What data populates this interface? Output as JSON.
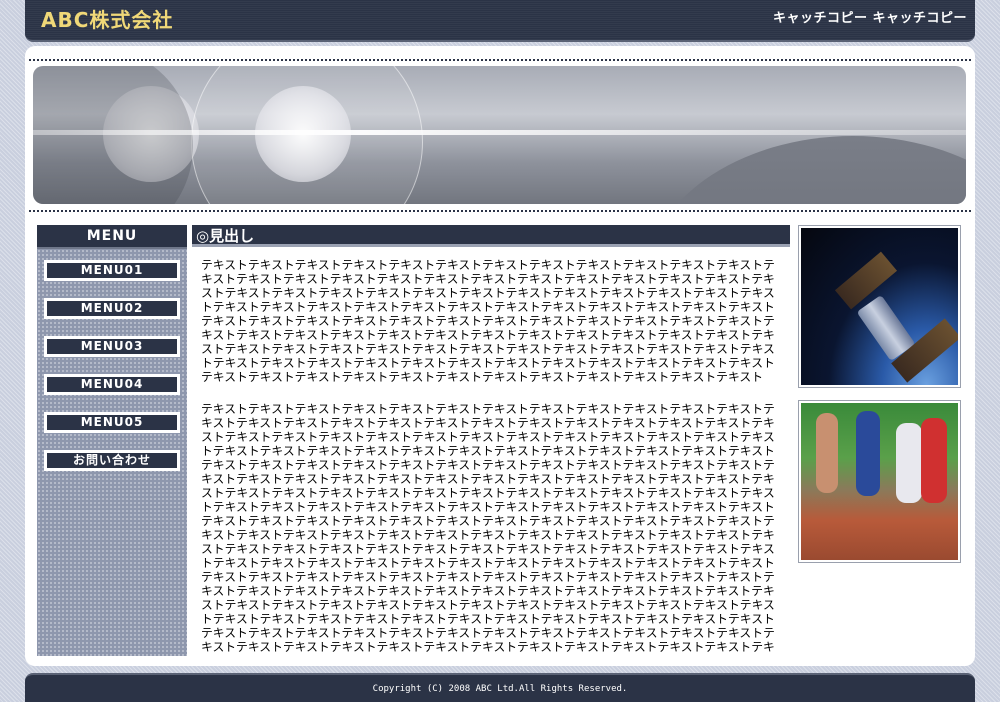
{
  "header": {
    "logo": "ABC株式会社",
    "catch_copy": "キャッチコピー キャッチコピー"
  },
  "menu": {
    "title": "MENU",
    "items": [
      "MENU01",
      "MENU02",
      "MENU03",
      "MENU04",
      "MENU05",
      "お問い合わせ"
    ]
  },
  "main": {
    "heading": "◎見出し",
    "paragraph1": "テキストテキストテキストテキストテキストテキストテキストテキストテキストテキストテキストテキストテキストテキストテキストテキストテキストテキストテキストテキストテキストテキストテキストテキストテキストテキストテキストテキストテキストテキストテキストテキストテキストテキストテキストテキストテキストテキストテキストテキストテキストテキストテキストテキストテキストテキストテキストテキストテキストテキストテキストテキストテキストテキストテキストテキストテキストテキストテキストテキストテキストテキストテキストテキストテキストテキストテキストテキストテキストテキストテキストテキストテキストテキストテキストテキストテキストテキストテキストテキストテキストテキストテキストテキストテキストテキストテキストテキストテキストテキストテキストテキストテキストテキストテキストテキストテキストテキストテキストテキストテキストテキストテキストテキストテキストテキストテキストテキストテキストテキスト",
    "paragraph2": "テキストテキストテキストテキストテキストテキストテキストテキストテキストテキストテキストテキストテキストテキストテキストテキストテキストテキストテキストテキストテキストテキストテキストテキストテキストテキストテキストテキストテキストテキストテキストテキストテキストテキストテキストテキストテキストテキストテキストテキストテキストテキストテキストテキストテキストテキストテキストテキストテキストテキストテキストテキストテキストテキストテキストテキストテキストテキストテキストテキストテキストテキストテキストテキストテキストテキストテキストテキストテキストテキストテキストテキストテキストテキストテキストテキストテキストテキストテキストテキストテキストテキストテキストテキストテキストテキストテキストテキストテキストテキストテキストテキストテキストテキストテキストテキストテキストテキストテキストテキストテキストテキストテキストテキストテキストテキストテキストテキストテキストテキストテキストテキストテキストテキストテキストテキストテキストテキストテキストテキストテキストテキストテキストテキストテキストテキストテキストテキストテキストテキストテキストテキストテキストテキストテキストテキストテキストテキストテキストテキストテキストテキストテキストテキストテキストテキストテキストテキストテキストテキストテキストテキストテキストテキストテキストテキストテキストテキストテキストテキストテキストテキストテキストテキストテキストテキストテキストテキストテキストテキストテキストテキストテキストテキストテキストテキストテキストテキストテキストテキストテキストテキストテキストテキストテキストテキストテキストテキストテキストテキストテキストテキストテキストテキストテキストテキストテキストテキストテキストテキストテキストテキストテキストテキストテキストテキストテキストテキストテキストテキストテキストテキストテキストテキストテキストテキストテキストテキストテキストテキストテキストテキストテキストテキストテキストテキストテキストテキストテキストテキストテキストテキストテキストテキストテキストテキストテキストテキストテキストテキストテキストテキストテキストテキストテキストテキストテキストテキストテキストテキストテキストテキストテキストテキストテキストテキストテキストテキストテキストテキスト"
  },
  "images": [
    "satellite-photo",
    "runners-photo"
  ],
  "footer": {
    "copyright": "Copyright (C) 2008 ABC Ltd.All Rights Reserved."
  },
  "colors": {
    "dark_navy": "#2b3346",
    "sidebar_blue": "#8e97ad",
    "logo_gold": "#f0d878",
    "page_bg": "#c9cfde"
  }
}
